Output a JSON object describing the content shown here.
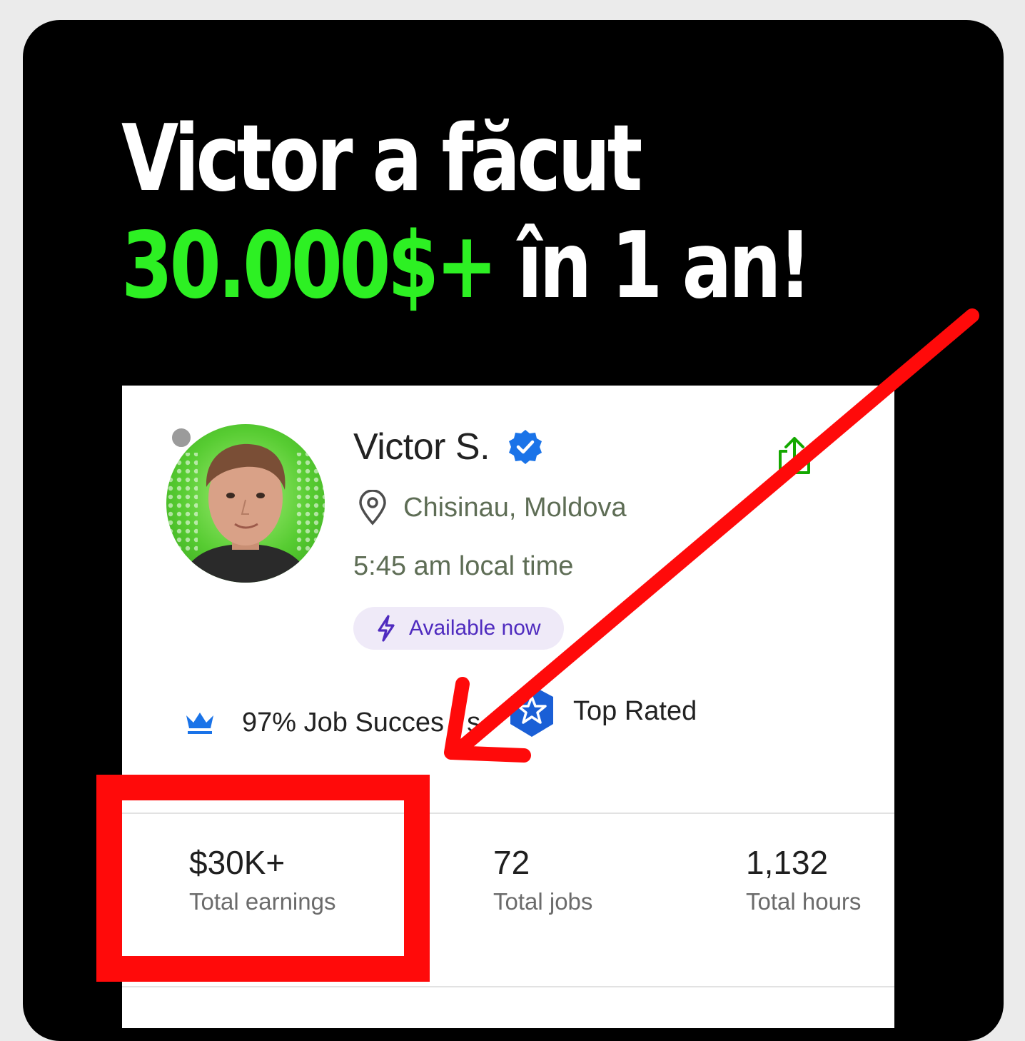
{
  "headline": {
    "line1": "Victor a făcut",
    "amount": "30.000$+",
    "rest": " în 1 an!"
  },
  "profile": {
    "name": "Victor S.",
    "location": "Chisinau, Moldova",
    "local_time": "5:45 am local time",
    "availability": "Available now",
    "job_success": "97% Job Succes",
    "job_success_tail": "s",
    "badge": "Top Rated"
  },
  "metrics": [
    {
      "value": "$30K+",
      "label": "Total earnings"
    },
    {
      "value": "72",
      "label": "Total jobs"
    },
    {
      "value": "1,132",
      "label": "Total hours"
    }
  ],
  "colors": {
    "accent_green": "#2df023",
    "annotation_red": "#ff0a0a",
    "verified_blue": "#1a73e8",
    "available_purple": "#4f2bbf"
  },
  "icons": [
    "verified-badge-icon",
    "share-icon",
    "location-pin-icon",
    "lightning-icon",
    "crown-icon",
    "top-rated-star-icon"
  ]
}
